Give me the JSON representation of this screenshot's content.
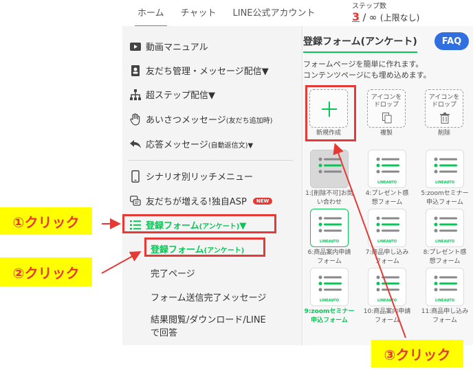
{
  "nav": {
    "tabs": [
      "ホーム",
      "チャット",
      "LINE公式アカウント"
    ],
    "step_label": "ステップ数",
    "step_count": "3",
    "step_separator": "/ ∞",
    "step_limit": "(上限なし)"
  },
  "sidebar": {
    "items": [
      {
        "label": "動画マニュアル",
        "icon": "play-icon"
      },
      {
        "label": "友だち管理・メッセージ配信▼",
        "icon": "people-book-icon"
      },
      {
        "label": "超ステップ配信▼",
        "icon": "hierarchy-icon"
      },
      {
        "label": "あいさつメッセージ",
        "sub": "(友だち追加時)",
        "icon": "hand-icon"
      },
      {
        "label": "応答メッセージ",
        "sub": "(自動返信文)▼",
        "icon": "reply-icon"
      },
      {
        "label": "シナリオ別リッチメニュー",
        "icon": "phone-icon"
      },
      {
        "label": "友だちが増える!独自ASP",
        "badge": "NEW",
        "icon": "chat-icon"
      },
      {
        "label": "登録フォーム",
        "sub": "(アンケート)",
        "suffix": "▼",
        "icon": "list-icon"
      }
    ],
    "submenu": [
      {
        "label": "登録フォーム",
        "sub": "(アンケート)"
      },
      {
        "label": "完了ページ"
      },
      {
        "label": "フォーム送信完了メッセージ"
      },
      {
        "label_line1": "結果閲覧/ダウンロード/LINE",
        "label_line2": "で回答"
      }
    ]
  },
  "panel": {
    "title": "登録フォーム(アンケート)",
    "faq": "FAQ",
    "desc_line1": "フォームページを簡単に作れます。",
    "desc_line2": "コンテンツページにも埋め込めます。",
    "actions": [
      {
        "caption": "新規作成",
        "icon": "plus-icon"
      },
      {
        "drop_line1": "アイコンを",
        "drop_line2": "ドロップ",
        "caption": "複製",
        "icon": "copy-icon"
      },
      {
        "drop_line1": "アイコンを",
        "drop_line2": "ドロップ",
        "caption": "削除",
        "icon": "trash-icon"
      }
    ],
    "forms": [
      {
        "line1": "1:[削除不可]お問",
        "line2": "い合わせ",
        "brand": ""
      },
      {
        "line1": "4:プレゼント感",
        "line2": "想フォーム",
        "brand": "LINEAUTO"
      },
      {
        "line1": "5:zoomセミナー",
        "line2": "申込フォーム",
        "brand": "LINEAUTO"
      },
      {
        "line1": "6:商品案内申請",
        "line2": "フォーム",
        "brand": "LINEAUTO"
      },
      {
        "line1": "7:商品申し込み",
        "line2": "フォーム",
        "brand": "LINEAUTO"
      },
      {
        "line1": "8:プレゼント感",
        "line2": "想フォーム",
        "brand": "LINEAUTO"
      },
      {
        "line1": "9:zoomセミナー",
        "line2": "申込フォーム",
        "brand": "LINEAUTO"
      },
      {
        "line1": "10:商品案内申請",
        "line2": "フォーム",
        "brand": "LINEAUTO"
      },
      {
        "line1": "11:商品申し込み",
        "line2": "フォーム",
        "brand": "LINEAUTO"
      }
    ]
  },
  "callouts": {
    "c1": "①クリック",
    "c2": "②クリック",
    "c3": "③クリック"
  },
  "colors": {
    "accent": "#06c755",
    "annotation": "#e53935",
    "callout_bg": "#ffff00",
    "faq": "#2f6fe0"
  }
}
